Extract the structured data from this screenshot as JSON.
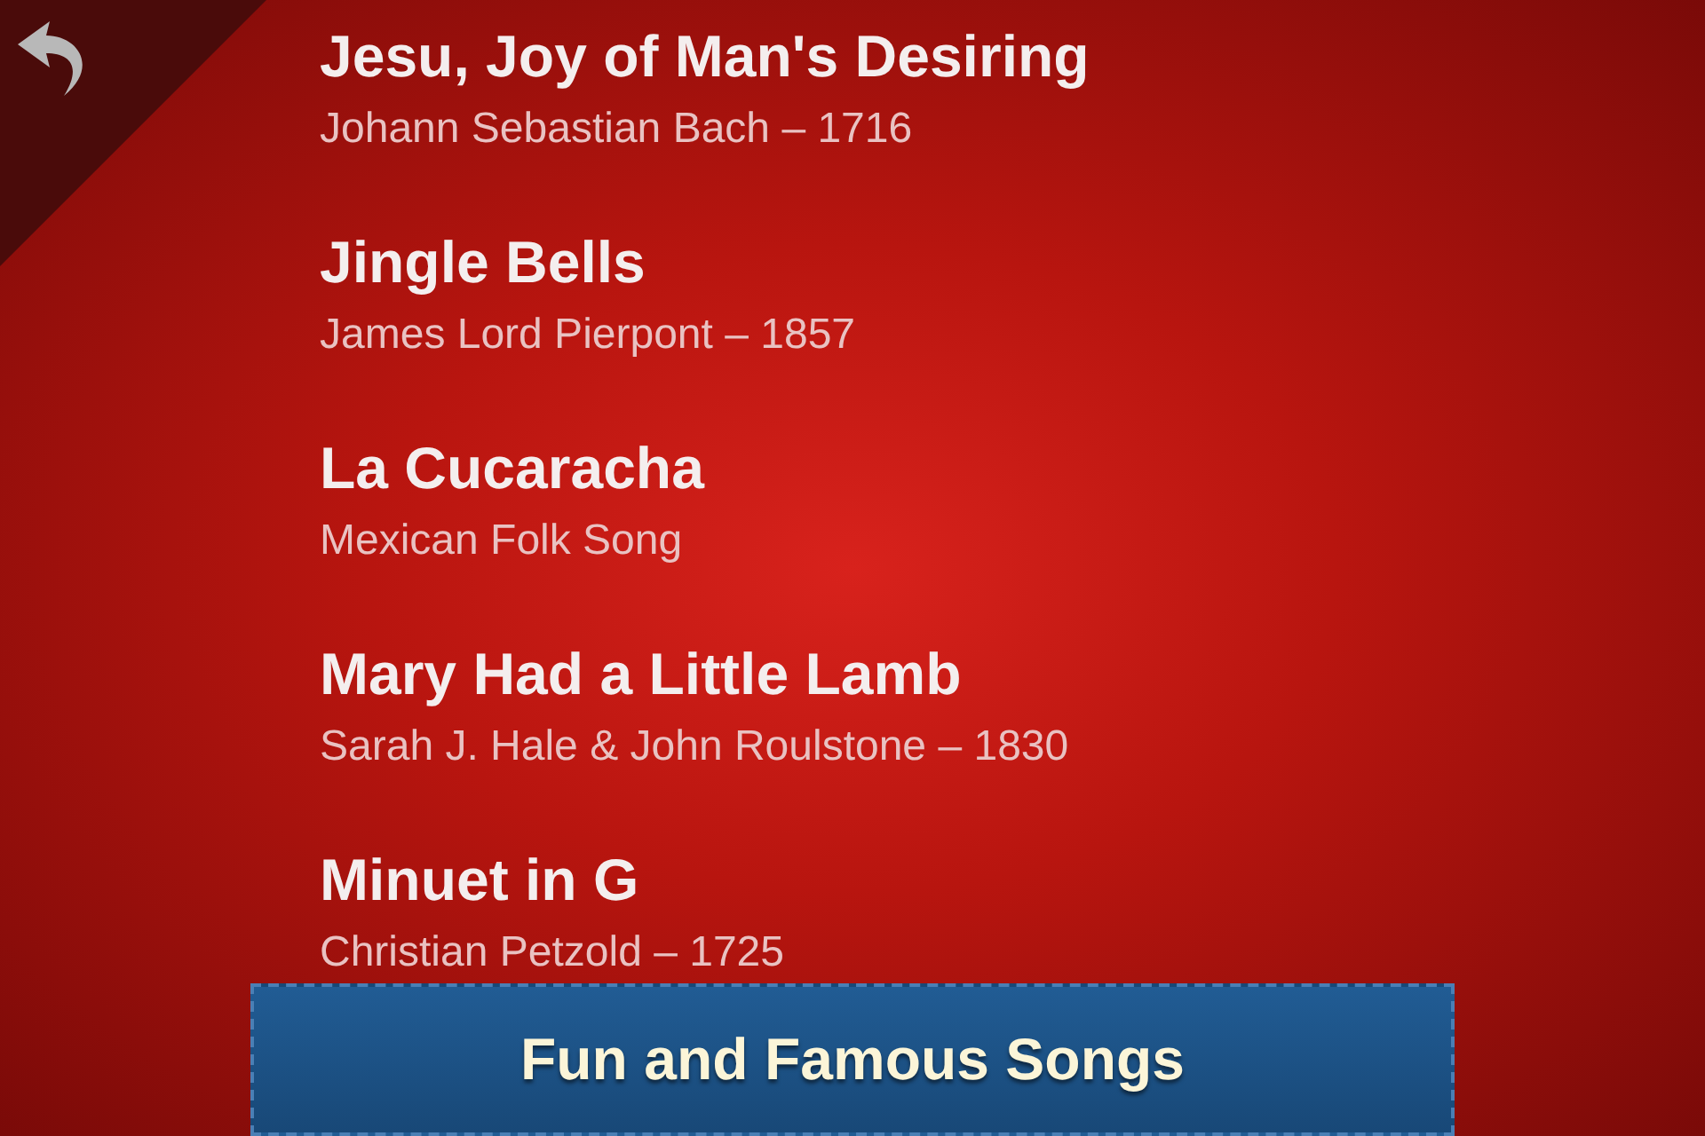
{
  "songs": [
    {
      "title": "Jesu, Joy of Man's Desiring",
      "subtitle": "Johann Sebastian Bach – 1716"
    },
    {
      "title": "Jingle Bells",
      "subtitle": "James Lord Pierpont – 1857"
    },
    {
      "title": "La Cucaracha",
      "subtitle": "Mexican Folk Song"
    },
    {
      "title": "Mary Had a Little Lamb",
      "subtitle": "Sarah J. Hale & John Roulstone – 1830"
    },
    {
      "title": "Minuet in G",
      "subtitle": "Christian Petzold – 1725"
    }
  ],
  "banner": {
    "title": "Fun and Famous Songs"
  }
}
